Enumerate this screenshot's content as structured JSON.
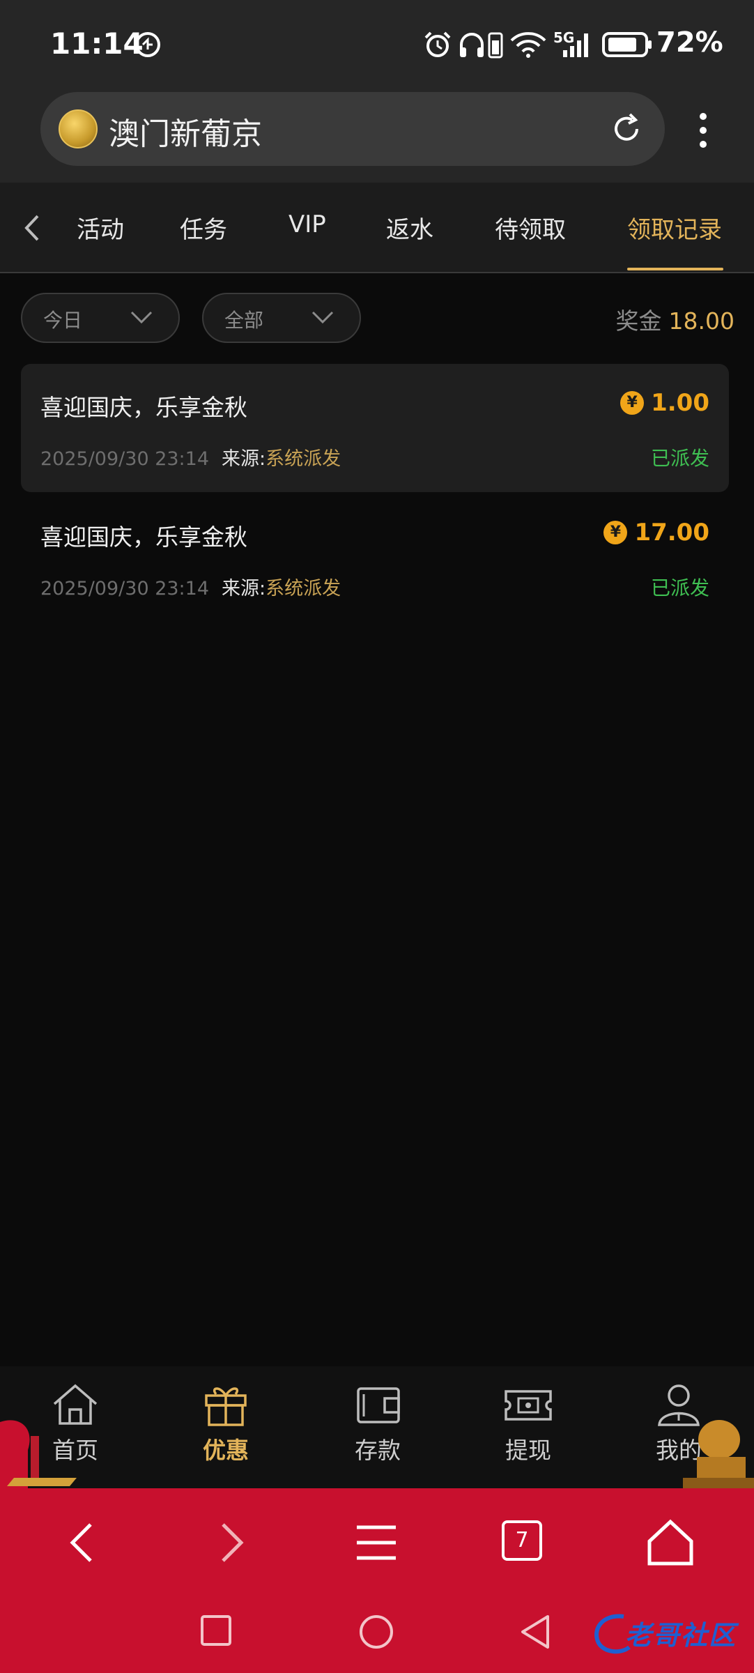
{
  "status_bar": {
    "time": "11:14",
    "battery": "72%",
    "network": "5G",
    "icons": [
      "sync-icon",
      "alarm-icon",
      "headphones-icon",
      "battery-small-icon",
      "wifi-icon",
      "signal-icon",
      "battery-icon"
    ]
  },
  "browser": {
    "site_title": "澳门新葡京",
    "tab_count": "7"
  },
  "tabs": {
    "items": [
      {
        "label": "活动"
      },
      {
        "label": "任务"
      },
      {
        "label": "VIP"
      },
      {
        "label": "返水"
      },
      {
        "label": "待领取"
      },
      {
        "label": "领取记录"
      }
    ],
    "active_index": 5
  },
  "filters": {
    "date": "今日",
    "type": "全部"
  },
  "bonus": {
    "label": "奖金",
    "value": "18.00"
  },
  "records": [
    {
      "title": "喜迎国庆，乐享金秋",
      "amount": "1.00",
      "datetime": "2025/09/30 23:14",
      "source_label": "来源:",
      "source": "系统派发",
      "status": "已派发"
    },
    {
      "title": "喜迎国庆，乐享金秋",
      "amount": "17.00",
      "datetime": "2025/09/30 23:14",
      "source_label": "来源:",
      "source": "系统派发",
      "status": "已派发"
    }
  ],
  "bottom_nav": {
    "items": [
      {
        "label": "首页",
        "icon": "home-icon"
      },
      {
        "label": "优惠",
        "icon": "gift-icon"
      },
      {
        "label": "存款",
        "icon": "wallet-icon"
      },
      {
        "label": "提现",
        "icon": "withdraw-icon"
      },
      {
        "label": "我的",
        "icon": "user-icon"
      }
    ],
    "active_index": 1
  },
  "watermark": "老哥社区",
  "colors": {
    "accent_gold": "#e3b45a",
    "amount_orange": "#f0a519",
    "status_green": "#3fbf52",
    "toolbar_red": "#c8102e"
  }
}
